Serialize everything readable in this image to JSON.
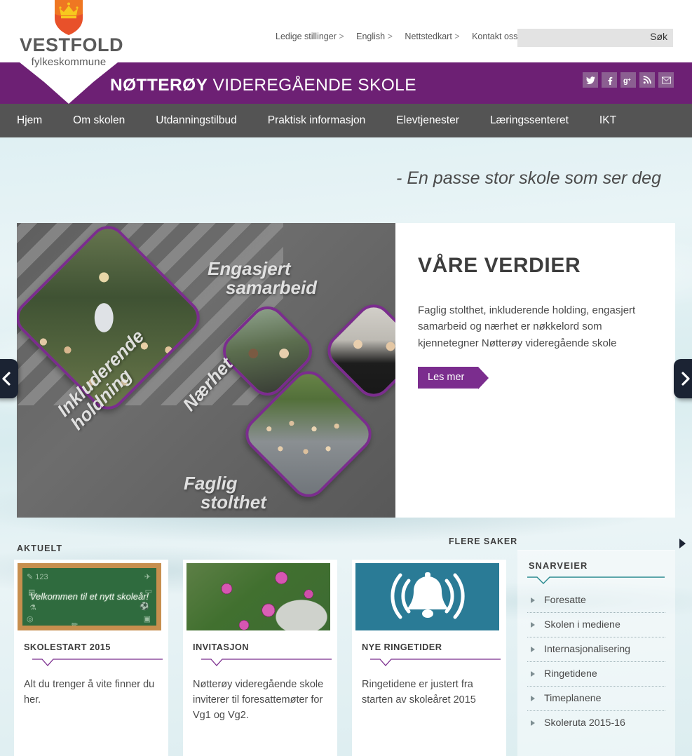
{
  "header": {
    "logo": {
      "org": "VESTFOLD",
      "sub": "fylkeskommune",
      "shield_icon": "crown-shield-icon"
    },
    "top_links": [
      {
        "label": "Ledige stillinger",
        "chev": ">"
      },
      {
        "label": "English",
        "chev": ">"
      },
      {
        "label": "Nettstedkart",
        "chev": ">"
      },
      {
        "label": "Kontakt oss",
        "chev": ">"
      }
    ],
    "search": {
      "value": "",
      "placeholder": "",
      "button_label": "Søk"
    },
    "school_name_bold": "NØTTERØY",
    "school_name_rest": " VIDEREGÅENDE SKOLE",
    "social": [
      {
        "name": "twitter-icon",
        "label": "Twitter"
      },
      {
        "name": "facebook-icon",
        "label": "Facebook"
      },
      {
        "name": "google-plus-icon",
        "label": "Google+"
      },
      {
        "name": "rss-icon",
        "label": "RSS"
      },
      {
        "name": "email-icon",
        "label": "E-post"
      }
    ]
  },
  "nav": {
    "items": [
      {
        "label": "Hjem"
      },
      {
        "label": "Om skolen"
      },
      {
        "label": "Utdanningstilbud"
      },
      {
        "label": "Praktisk informasjon"
      },
      {
        "label": "Elevtjenester"
      },
      {
        "label": "Læringssenteret"
      },
      {
        "label": "IKT"
      }
    ]
  },
  "tagline": "- En passe stor skole som ser deg",
  "hero": {
    "title": "VÅRE VERDIER",
    "body": "Faglig stolthet, inkluderende holding, engasjert samarbeid og nærhet er nøkkelord som kjennetegner Nøtterøy videregående skole",
    "cta": "Les mer",
    "collage_words": {
      "engasjert": "Engasjert",
      "samarbeid": "samarbeid",
      "naerhet": "Nærhet",
      "inkluderende": "Inkluderende",
      "holdning": "holdning",
      "faglig": "Faglig",
      "stolthet": "stolthet"
    },
    "prev_label": "‹",
    "next_label": "›"
  },
  "news": {
    "section_label": "AKTUELT",
    "more_label": "FLERE SAKER",
    "cards": [
      {
        "thumb": "chalkboard-image",
        "thumb_text": "Velkommen til et nytt skoleår!",
        "title": "SKOLESTART 2015",
        "text": "Alt du trenger å vite finner du her."
      },
      {
        "thumb": "flowers-image",
        "thumb_text": "",
        "title": "INVITASJON",
        "text": "Nøtterøy videregående skole inviterer til foresattemøter for Vg1 og Vg2."
      },
      {
        "thumb": "bell-icon-image",
        "thumb_text": "",
        "title": "NYE RINGETIDER",
        "text": "Ringetidene er justert fra starten av skoleåret 2015"
      }
    ]
  },
  "shortcuts": {
    "title": "SNARVEIER",
    "items": [
      {
        "label": "Foresatte"
      },
      {
        "label": "Skolen i mediene"
      },
      {
        "label": "Internasjonalisering"
      },
      {
        "label": "Ringetidene"
      },
      {
        "label": "Timeplanene"
      },
      {
        "label": "Skoleruta 2015-16"
      }
    ]
  },
  "colors": {
    "purple": "#6d2074",
    "purple_accent": "#7b2d8e",
    "nav_gray": "#545454",
    "teal": "#2a8a8f",
    "bell_bg": "#2a7b96"
  }
}
